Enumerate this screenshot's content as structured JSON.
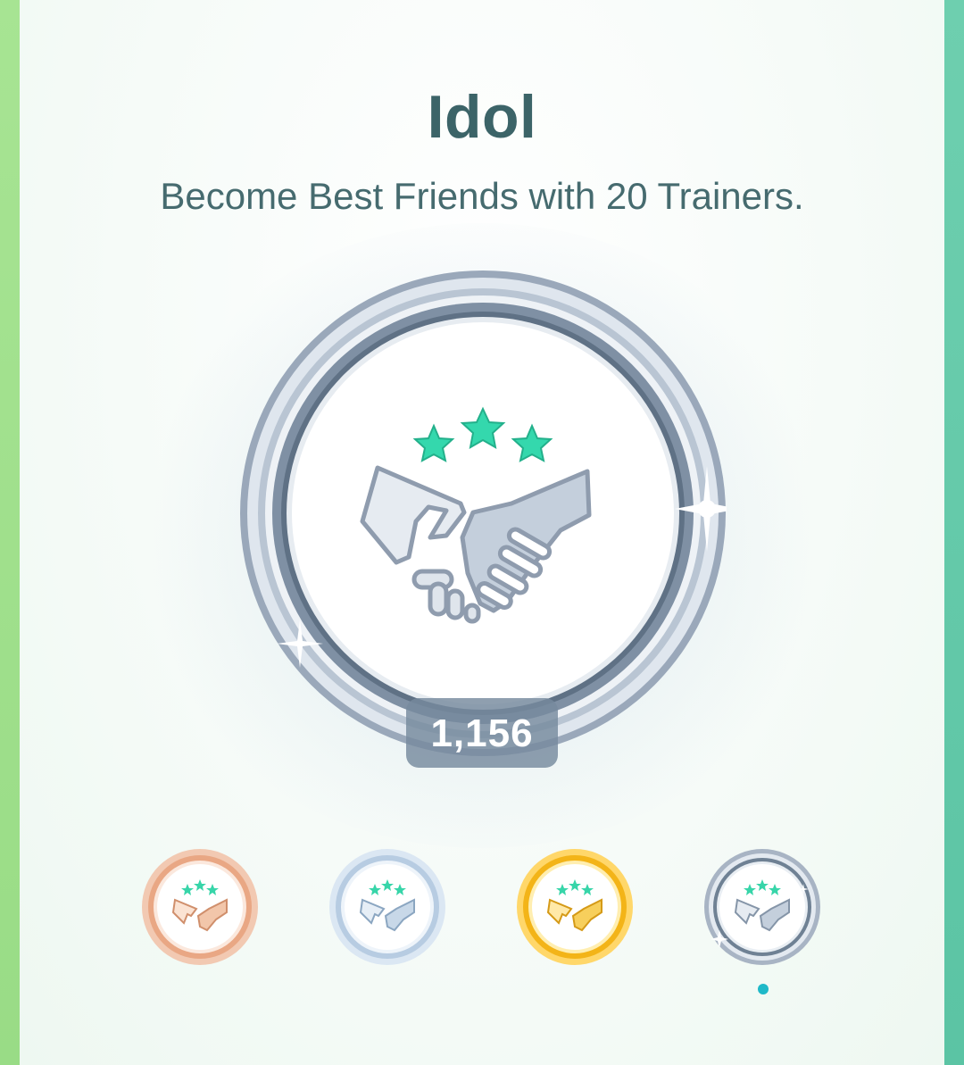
{
  "badge": {
    "title": "Idol",
    "description": "Become Best Friends with 20 Trainers.",
    "count": "1,156",
    "icon": "handshake-icon",
    "stars": 3,
    "colors": {
      "accent_star": "#2fd6a8",
      "platinum_ring": "#8c9cb0",
      "count_badge": "#768a9e",
      "page_dot": "#1fb9c8"
    }
  },
  "tiers": [
    {
      "name": "bronze",
      "icon": "handshake-icon"
    },
    {
      "name": "silver",
      "icon": "handshake-icon"
    },
    {
      "name": "gold",
      "icon": "handshake-icon"
    },
    {
      "name": "platinum",
      "icon": "handshake-icon"
    }
  ],
  "pager": {
    "selected_tier": "platinum"
  }
}
